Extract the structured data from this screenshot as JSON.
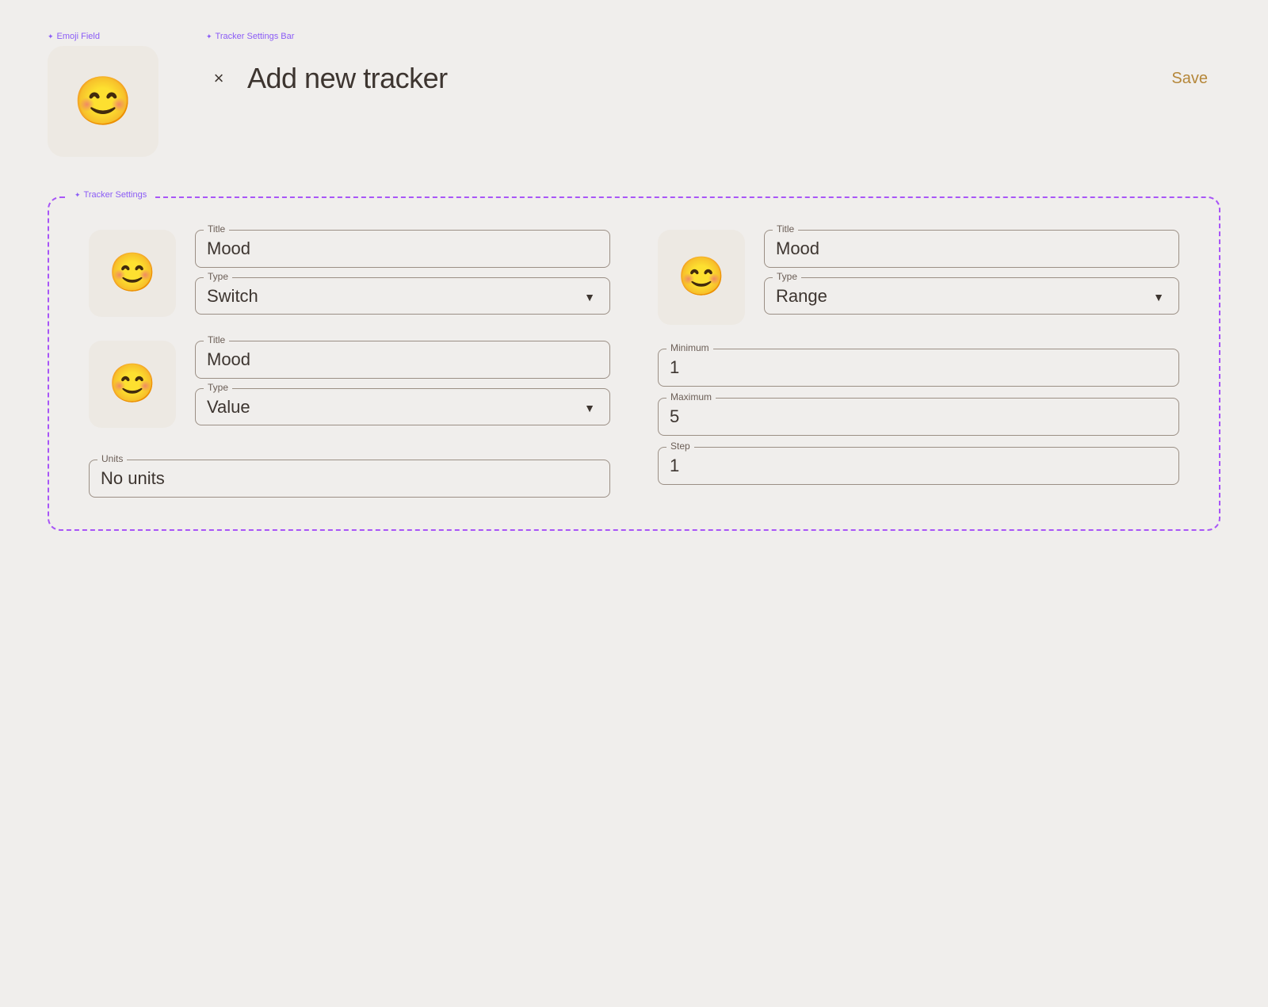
{
  "labels": {
    "emoji_field": "Emoji Field",
    "tracker_settings_bar": "Tracker Settings Bar",
    "tracker_settings": "Tracker Settings"
  },
  "header": {
    "title": "Add new tracker",
    "save_label": "Save",
    "close_icon": "×"
  },
  "emoji": "😊",
  "tracker1": {
    "title_label": "Title",
    "title_value": "Mood",
    "type_label": "Type",
    "type_value": "Switch",
    "type_options": [
      "Switch",
      "Value",
      "Range"
    ]
  },
  "tracker2": {
    "title_label": "Title",
    "title_value": "Mood",
    "type_label": "Type",
    "type_value": "Value",
    "type_options": [
      "Switch",
      "Value",
      "Range"
    ],
    "units_label": "Units",
    "units_value": "No units"
  },
  "tracker3": {
    "title_label": "Title",
    "title_value": "Mood",
    "type_label": "Type",
    "type_value": "Range",
    "type_options": [
      "Switch",
      "Value",
      "Range"
    ],
    "minimum_label": "Minimum",
    "minimum_value": "1",
    "maximum_label": "Maximum",
    "maximum_value": "5",
    "step_label": "Step",
    "step_value": "1"
  }
}
